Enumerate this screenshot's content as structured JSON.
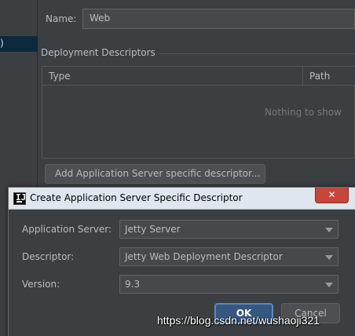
{
  "background": {
    "left_item": ")",
    "name_label": "Name:",
    "name_value": "Web",
    "section_title": "Deployment Descriptors",
    "table": {
      "columns": [
        "Type",
        "Path"
      ],
      "empty_text": "Nothing to show"
    },
    "add_button_label": "Add Application Server specific descriptor..."
  },
  "dialog": {
    "title": "Create Application Server Specific Descriptor",
    "close_label": "✕",
    "fields": {
      "server": {
        "label": "Application Server:",
        "value": "Jetty Server"
      },
      "descriptor": {
        "label": "Descriptor:",
        "value": "Jetty Web Deployment Descriptor"
      },
      "version": {
        "label": "Version:",
        "value": "9.3"
      }
    },
    "ok_label": "OK",
    "cancel_label": "Cancel"
  },
  "watermark": "https://blog.csdn.net/wushaoji321",
  "colors": {
    "background": "#3c3f41",
    "input": "#45494a",
    "ok_button": "#365880",
    "titlebar": "#dfe6ee",
    "close_button": "#c7463a"
  }
}
